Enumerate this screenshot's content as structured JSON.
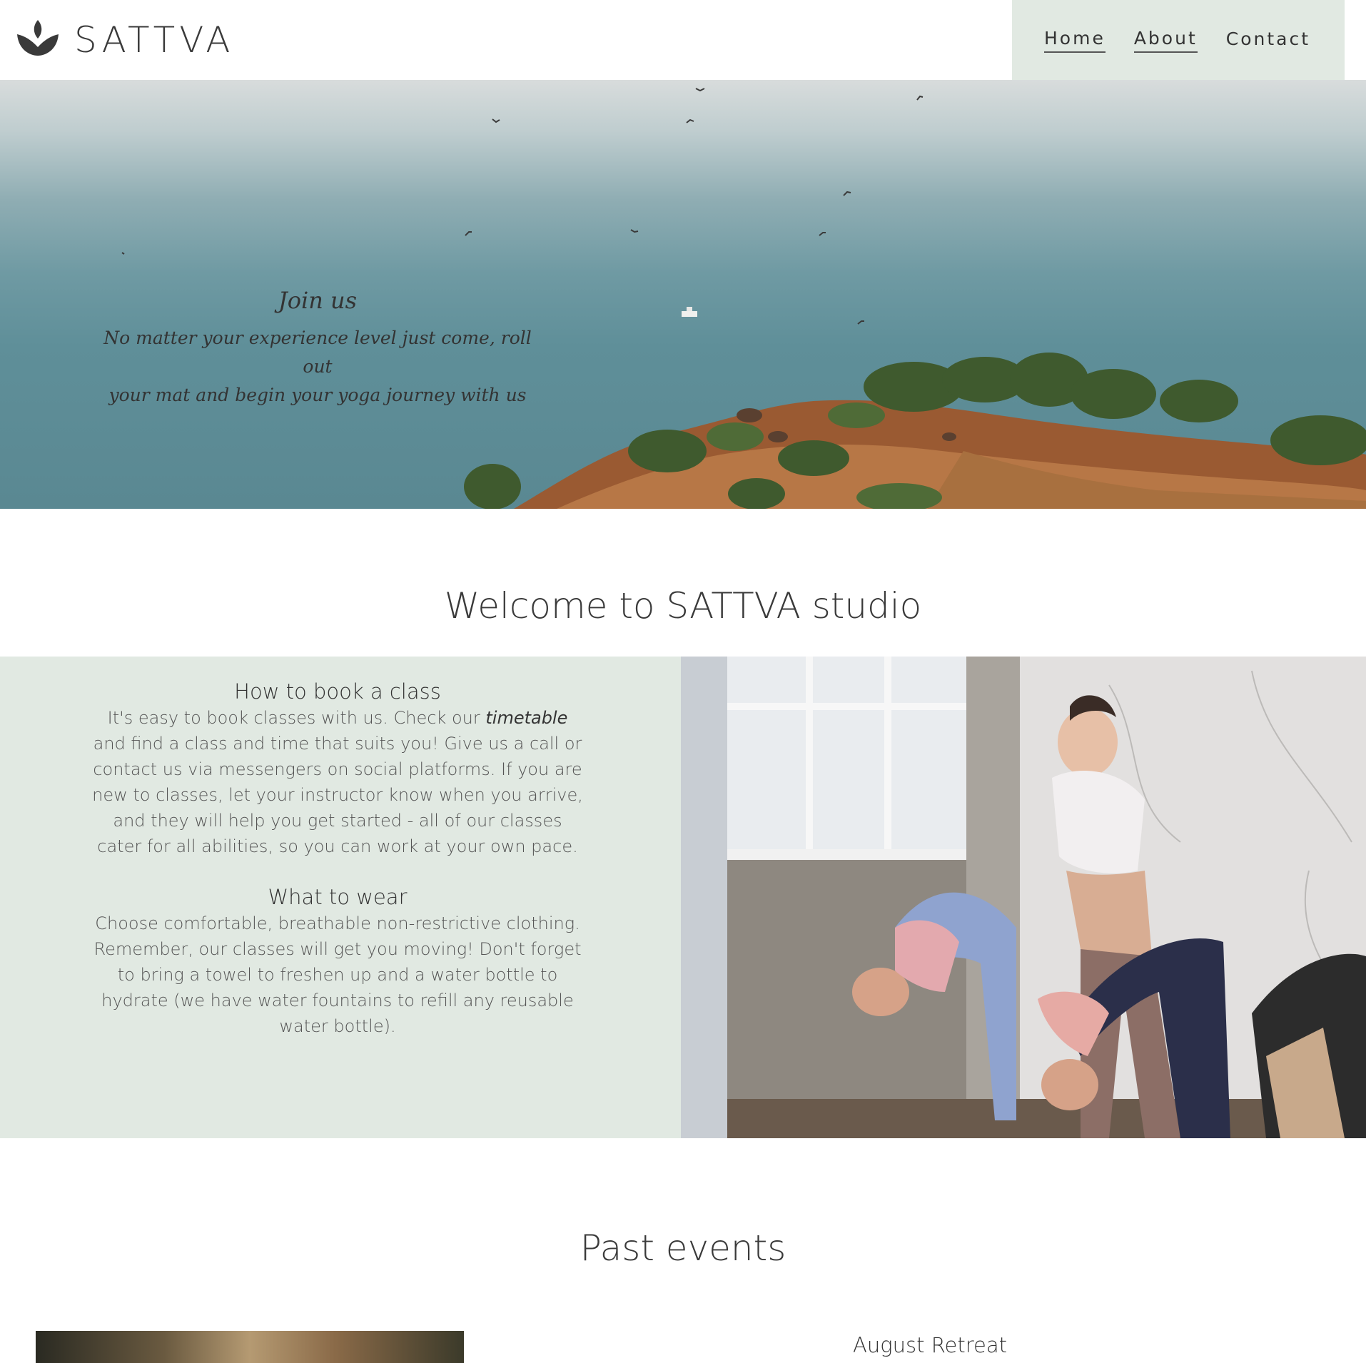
{
  "header": {
    "logo_text": "SATTVA",
    "logo_icon": "lotus-icon",
    "nav": [
      {
        "label": "Home"
      },
      {
        "label": "About"
      },
      {
        "label": "Contact"
      }
    ]
  },
  "hero": {
    "title": "Join us",
    "subtitle_line1": "No matter your experience level just come, roll out",
    "subtitle_line2": "your mat and begin your yoga journey with us"
  },
  "welcome": {
    "title": "Welcome to SATTVA studio"
  },
  "info": {
    "book": {
      "heading": "How to book a class",
      "text_before": "It's easy to book classes with us. Check our ",
      "emphasis": "timetable",
      "text_after": " and find a class and time that suits you! Give us a call or contact us via messengers on social platforms. If you are new to classes, let your instructor know when you arrive, and they will help you get started - all of our classes cater for all abilities, so you can work at your own pace."
    },
    "wear": {
      "heading": "What to wear",
      "text": "Choose comfortable, breathable non-restrictive clothing. Remember, our classes will get you moving! Don't forget to bring a towel to freshen up and a water bottle to hydrate (we have water fountains to refill any reusable water bottle)."
    }
  },
  "events": {
    "title": "Past events",
    "items": [
      {
        "title": "August Retreat"
      }
    ]
  },
  "colors": {
    "accent_bg": "#e1e9e2",
    "text": "#333333"
  }
}
